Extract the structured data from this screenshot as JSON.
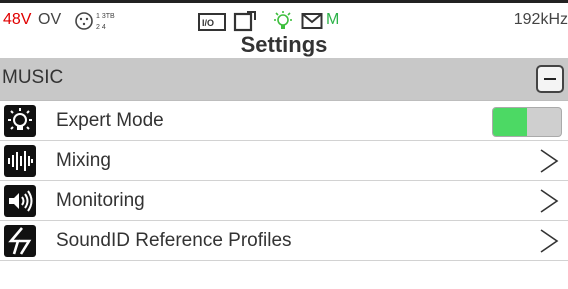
{
  "status_bar": {
    "phantom_power": "48V",
    "overload": "OV",
    "xlr_pins": "1 3TB 2 4",
    "sample_rate": "192kHz",
    "mode_indicator": "M",
    "icons": [
      "xlr-connector-icon",
      "io-inputs-icon",
      "bulb-icon",
      "mail-icon"
    ]
  },
  "title": "Settings",
  "section": {
    "label": "MUSIC"
  },
  "rows": [
    {
      "label": "Expert Mode",
      "icon": "expert-bulb-icon",
      "control": "toggle",
      "toggle_on": true
    },
    {
      "label": "Mixing",
      "icon": "mixing-waveform-icon",
      "control": "chevron"
    },
    {
      "label": "Monitoring",
      "icon": "speaker-icon",
      "control": "chevron"
    },
    {
      "label": "SoundID Reference Profiles",
      "icon": "soundid-icon",
      "control": "chevron"
    }
  ],
  "colors": {
    "phantom_red": "#e00000",
    "accent_green": "#2db34a",
    "toggle_green": "#4cd964",
    "section_gray": "#c8c8c8"
  }
}
